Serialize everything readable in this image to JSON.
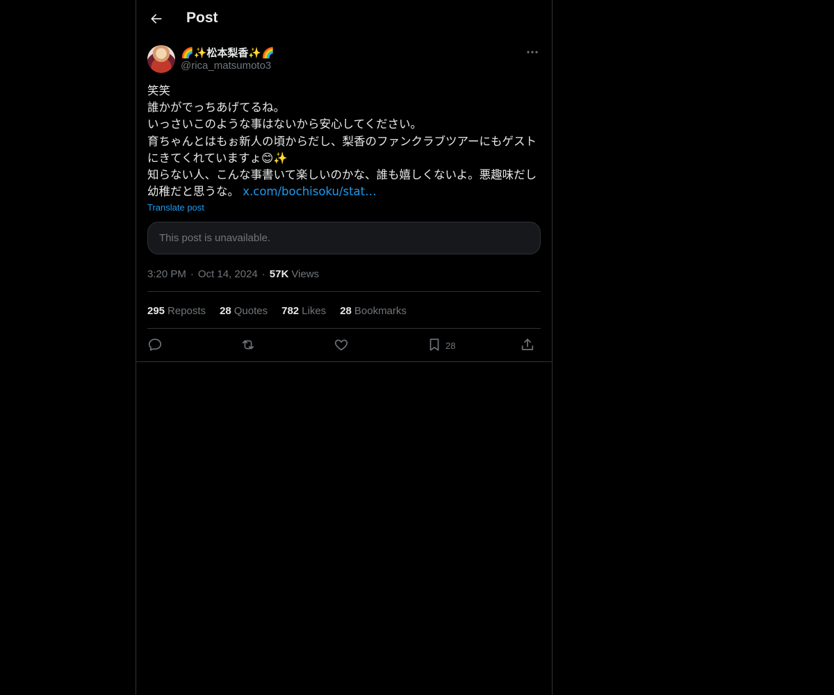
{
  "header": {
    "title": "Post",
    "back_icon": "arrow-left-icon"
  },
  "post": {
    "author": {
      "display_name": "🌈✨松本梨香✨🌈",
      "handle": "@rica_matsumoto3"
    },
    "text": "笑笑\n誰かがでっちあげてるね。\nいっさいこのような事はないから安心してください。\n育ちゃんとはもぉ新人の頃からだし、梨香のファンクラブツアーにもゲストにきてくれていますょ😊✨\n知らない人、こんな事書いて楽しいのかな、誰も嬉しくないよ。悪趣味だし幼稚だと思うな。 ",
    "link": "x.com/bochisoku/stat…",
    "translate_label": "Translate post",
    "quoted_unavailable": "This post is unavailable.",
    "time": "3:20 PM",
    "separator": "·",
    "date": "Oct 14, 2024",
    "views_count": "57K",
    "views_label": "Views",
    "stats": {
      "reposts_count": "295",
      "reposts_label": "Reposts",
      "quotes_count": "28",
      "quotes_label": "Quotes",
      "likes_count": "782",
      "likes_label": "Likes",
      "bookmarks_count": "28",
      "bookmarks_label": "Bookmarks"
    },
    "actions": {
      "bookmark_count": "28"
    }
  },
  "colors": {
    "background": "#000000",
    "text": "#e7e9ea",
    "muted": "#71767b",
    "accent": "#1d9bf0",
    "border": "#2f3336"
  }
}
